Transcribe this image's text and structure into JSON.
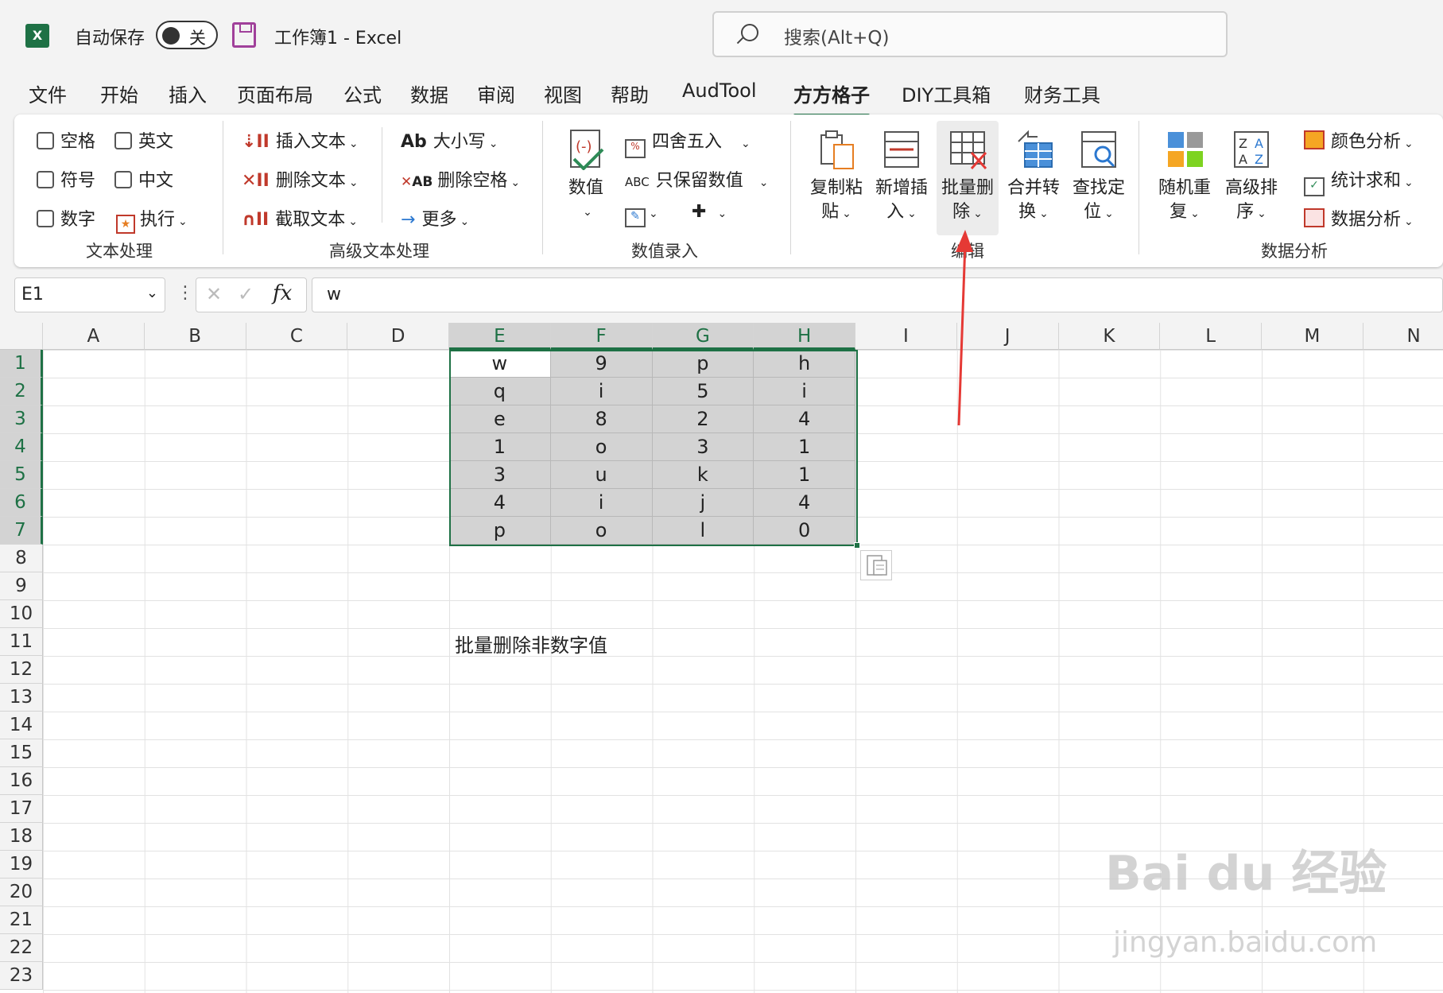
{
  "titlebar": {
    "autosave_label": "自动保存",
    "autosave_state": "关",
    "doc_title": "工作簿1  -  Excel",
    "search_placeholder": "搜索(Alt+Q)"
  },
  "menu": {
    "tabs": [
      "文件",
      "开始",
      "插入",
      "页面布局",
      "公式",
      "数据",
      "审阅",
      "视图",
      "帮助",
      "AudTool",
      "方方格子",
      "DIY工具箱",
      "财务工具"
    ],
    "active_tab": "方方格子"
  },
  "ribbon": {
    "text_processing": {
      "checkboxes": [
        "空格",
        "英文",
        "符号",
        "中文",
        "数字"
      ],
      "execute": "执行",
      "group_label": "文本处理"
    },
    "advanced_text": {
      "insert": "插入文本",
      "delete": "删除文本",
      "extract": "截取文本",
      "case": "大小写",
      "delete_spaces": "删除空格",
      "more": "更多",
      "group_label": "高级文本处理"
    },
    "numeric_entry": {
      "value": "数值",
      "round": "四舍五入",
      "keep_numeric": "只保留数值",
      "group_label": "数值录入"
    },
    "edit": {
      "copy_paste": [
        "复制粘",
        "贴"
      ],
      "add_insert": [
        "新增插",
        "入"
      ],
      "batch_delete": [
        "批量删",
        "除"
      ],
      "merge_convert": [
        "合并转",
        "换"
      ],
      "find_locate": [
        "查找定",
        "位"
      ],
      "group_label": "编辑"
    },
    "data_analysis": {
      "random_repeat": [
        "随机重",
        "复"
      ],
      "advanced_sort": [
        "高级排",
        "序"
      ],
      "color_analysis": "颜色分析",
      "stat_sum": "统计求和",
      "data_analysis": "数据分析",
      "group_label": "数据分析"
    }
  },
  "formula_bar": {
    "name_box": "E1",
    "fx": "fx",
    "content": "w"
  },
  "sheet": {
    "columns": [
      "A",
      "B",
      "C",
      "D",
      "E",
      "F",
      "G",
      "H",
      "I",
      "J",
      "K",
      "L",
      "M",
      "N"
    ],
    "rows": [
      "1",
      "2",
      "3",
      "4",
      "5",
      "6",
      "7",
      "8",
      "9",
      "10",
      "11",
      "12",
      "13",
      "14",
      "15",
      "16",
      "17",
      "18",
      "19",
      "20",
      "21",
      "22",
      "23"
    ],
    "selected_columns": [
      "E",
      "F",
      "G",
      "H"
    ],
    "selected_rows": [
      "1",
      "2",
      "3",
      "4",
      "5",
      "6",
      "7"
    ],
    "data": [
      [
        "w",
        "9",
        "p",
        "h"
      ],
      [
        "q",
        "i",
        "5",
        "i"
      ],
      [
        "e",
        "8",
        "2",
        "4"
      ],
      [
        "1",
        "o",
        "3",
        "1"
      ],
      [
        "3",
        "u",
        "k",
        "1"
      ],
      [
        "4",
        "i",
        "j",
        "4"
      ],
      [
        "p",
        "o",
        "l",
        "0"
      ]
    ],
    "note_E11": "批量删除非数字值"
  },
  "watermark": {
    "brand": "Bai du 经验",
    "url": "jingyan.baidu.com"
  },
  "colors": {
    "excel_green": "#1e7145",
    "annotation_arrow": "#e53935"
  }
}
